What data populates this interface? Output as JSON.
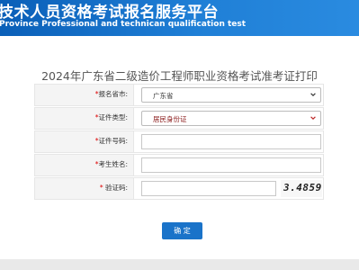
{
  "header": {
    "title": "技术人员资格考试报名服务平台",
    "subtitle": "Province Professional and technican qualification test"
  },
  "page": {
    "title": "2024年广东省二级造价工程师职业资格考试准考证打印"
  },
  "form": {
    "city": {
      "label": "报名省市:",
      "value": "广东省"
    },
    "id_type": {
      "label": "证件类型:",
      "value": "居民身份证"
    },
    "id_number": {
      "label": "证件号码:",
      "value": ""
    },
    "name": {
      "label": "考生姓名:",
      "value": ""
    },
    "captcha": {
      "label": "验证码:",
      "value": "",
      "image_text": "3.4859"
    },
    "required_mark": "*"
  },
  "buttons": {
    "submit": "确 定"
  },
  "colors": {
    "banner": "#1a73c9",
    "accent": "#1a73c9",
    "required": "#dd0000"
  }
}
